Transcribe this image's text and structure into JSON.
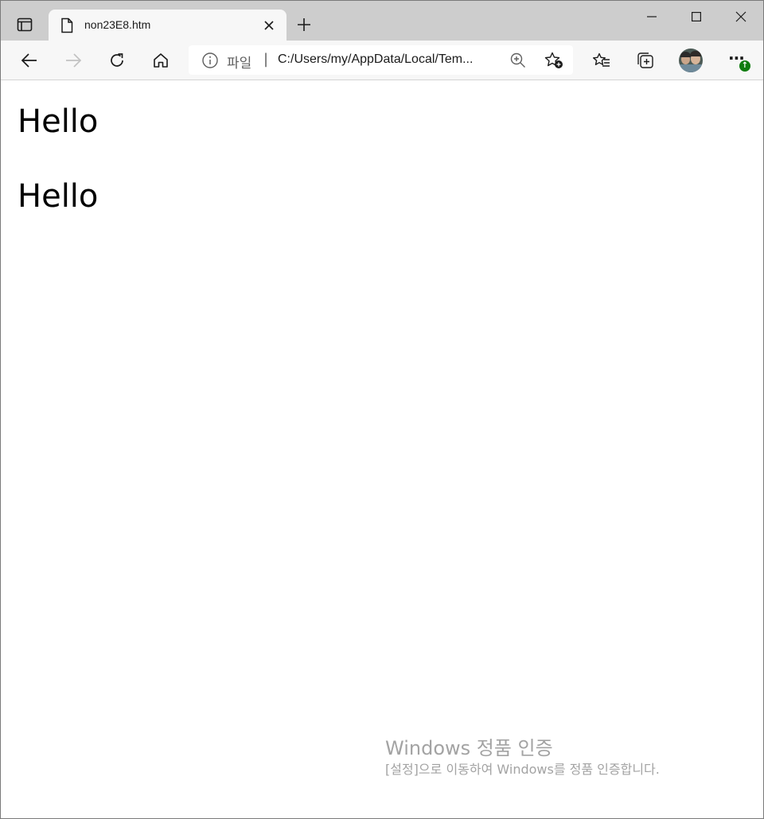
{
  "browser": {
    "tab": {
      "title": "non23E8.htm"
    },
    "address": {
      "scheme_label": "파일",
      "separator": "|",
      "url": "C:/Users/my/AppData/Local/Tem..."
    },
    "icons": {
      "tab_actions": "tab-actions-icon",
      "page": "page-icon",
      "close_tab": "close-icon",
      "new_tab": "plus-icon",
      "minimize": "minimize-icon",
      "maximize": "maximize-icon",
      "close_window": "close-icon",
      "back": "back-arrow-icon",
      "forward": "forward-arrow-icon",
      "refresh": "refresh-icon",
      "home": "home-icon",
      "info": "info-icon",
      "zoom": "zoom-in-icon",
      "add_favorite": "star-add-icon",
      "favorites": "favorites-icon",
      "collections": "collections-icon",
      "profile": "avatar",
      "more": "more-icon",
      "update": "update-arrow-icon"
    },
    "colors": {
      "titlebar": "#cdcdcd",
      "toolbar": "#f7f7f7",
      "update_badge": "#107c10"
    }
  },
  "page": {
    "headings": [
      "Hello",
      "Hello"
    ]
  },
  "watermark": {
    "title": "Windows 정품 인증",
    "subtitle": "[설정]으로 이동하여 Windows를 정품 인증합니다."
  }
}
